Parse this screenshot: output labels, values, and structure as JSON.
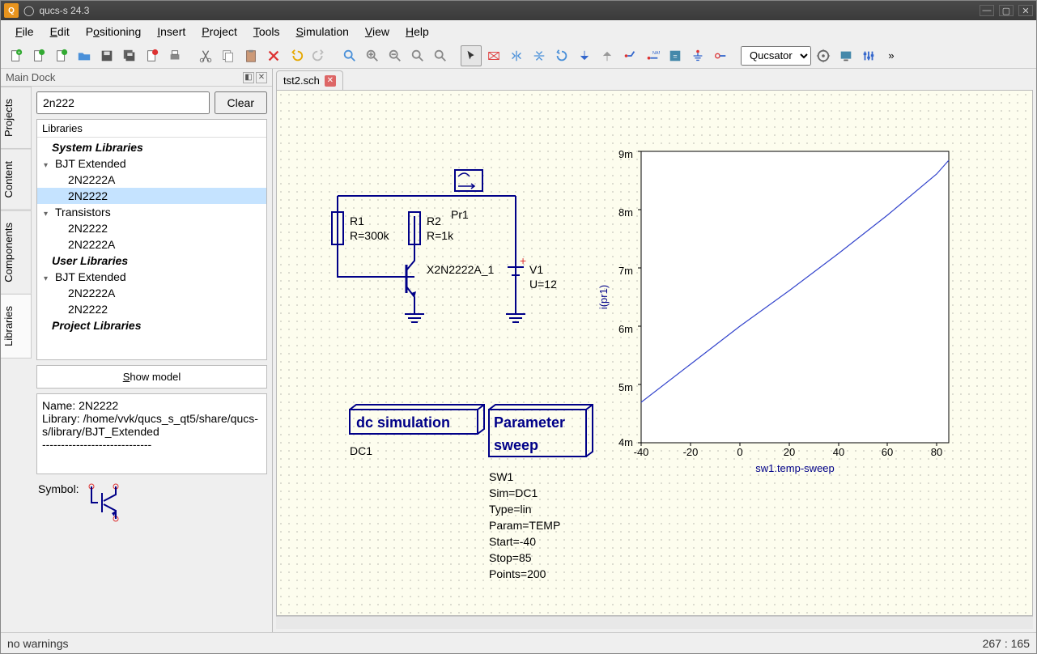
{
  "title": "qucs-s 24.3",
  "menubar": [
    "File",
    "Edit",
    "Positioning",
    "Insert",
    "Project",
    "Tools",
    "Simulation",
    "View",
    "Help"
  ],
  "simulator": "Qucsator",
  "dock": {
    "title": "Main Dock",
    "tabs": [
      "Projects",
      "Content",
      "Components",
      "Libraries"
    ],
    "search_value": "2n222",
    "clear_label": "Clear",
    "lib_label": "Libraries",
    "tree": {
      "sys_hdr": "System Libraries",
      "grp1": "BJT Extended",
      "grp1_items": [
        "2N2222A",
        "2N2222"
      ],
      "grp2": "Transistors",
      "grp2_items": [
        "2N2222",
        "2N2222A"
      ],
      "user_hdr": "User Libraries",
      "grp3": "BJT Extended",
      "grp3_items": [
        "2N2222A",
        "2N2222"
      ],
      "proj_hdr": "Project Libraries"
    },
    "show_model": "Show model",
    "desc": "Name: 2N2222\nLibrary: /home/vvk/qucs_s_qt5/share/qucs-s/library/BJT_Extended\n-----------------------------",
    "symbol_label": "Symbol:"
  },
  "filetab": "tst2.sch",
  "schematic": {
    "probe": "Pr1",
    "r1_name": "R1",
    "r1_val": "R=300k",
    "r2_name": "R2",
    "r2_val": "R=1k",
    "q_name": "X2N2222A_1",
    "v_name": "V1",
    "v_val": "U=12",
    "dc_title": "dc simulation",
    "dc_name": "DC1",
    "sw_title": "Parameter sweep",
    "sw_name": "SW1",
    "sw_p1": "Sim=DC1",
    "sw_p2": "Type=lin",
    "sw_p3": "Param=TEMP",
    "sw_p4": "Start=-40",
    "sw_p5": "Stop=85",
    "sw_p6": "Points=200"
  },
  "chart_data": {
    "type": "line",
    "xlabel": "sw1.temp-sweep",
    "ylabel": "i(pr1)",
    "x": [
      -40,
      -20,
      0,
      20,
      40,
      60,
      80,
      85
    ],
    "y": [
      0.0047,
      0.00535,
      0.006,
      0.0066,
      0.00725,
      0.0079,
      0.0086,
      0.00885
    ],
    "xlim": [
      -40,
      85
    ],
    "ylim": [
      0.004,
      0.009
    ],
    "xticks": [
      -40,
      -20,
      0,
      20,
      40,
      60,
      80
    ],
    "yticks_labels": [
      "4m",
      "5m",
      "6m",
      "7m",
      "8m",
      "9m"
    ]
  },
  "status_left": "no warnings",
  "status_right": "267 : 165"
}
